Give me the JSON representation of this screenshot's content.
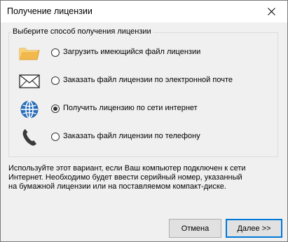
{
  "window": {
    "title": "Получение лицензии"
  },
  "group": {
    "title": "Выберите способ получения лицензии",
    "options": [
      {
        "label": "Загрузить имеющийся файл лицензии",
        "icon": "folder-icon",
        "checked": false
      },
      {
        "label": "Заказать файл лицензии по электронной почте",
        "icon": "envelope-icon",
        "checked": false
      },
      {
        "label": "Получить лицензию по сети интернет",
        "icon": "globe-icon",
        "checked": true
      },
      {
        "label": "Заказать файл лицензии по телефону",
        "icon": "phone-icon",
        "checked": false
      }
    ]
  },
  "description": {
    "lines": [
      "Используйте этот вариант, если Ваш компьютер подключен к сети",
      "Интернет. Необходимо будет ввести серийный номер, указанный",
      "на бумажной лицензии или на поставляемом компакт-диске."
    ]
  },
  "buttons": {
    "cancel": "Отмена",
    "next": "Далее >>"
  },
  "colors": {
    "folder": "#f5c65c",
    "globe": "#1f5fa8",
    "envelope": "#333333",
    "phone": "#333333",
    "accent": "#0078d7"
  }
}
